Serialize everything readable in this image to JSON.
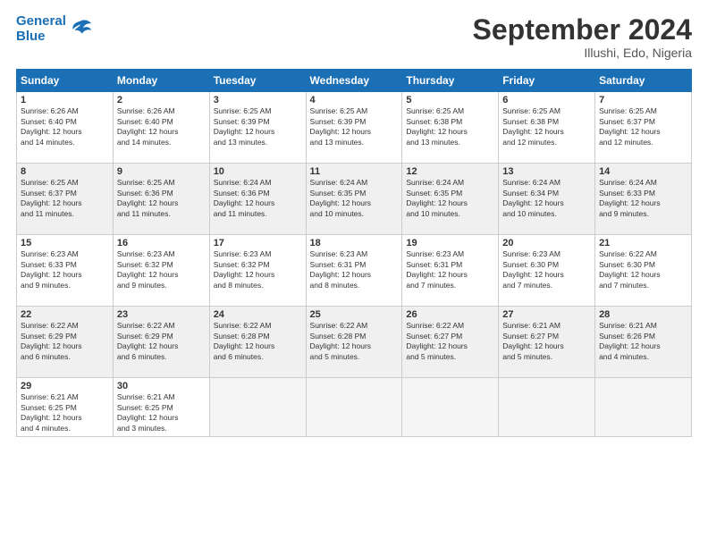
{
  "logo": {
    "line1": "General",
    "line2": "Blue"
  },
  "title": "September 2024",
  "subtitle": "Illushi, Edo, Nigeria",
  "weekdays": [
    "Sunday",
    "Monday",
    "Tuesday",
    "Wednesday",
    "Thursday",
    "Friday",
    "Saturday"
  ],
  "weeks": [
    [
      {
        "day": "1",
        "sunrise": "6:26 AM",
        "sunset": "6:40 PM",
        "daylight": "12 hours and 14 minutes."
      },
      {
        "day": "2",
        "sunrise": "6:26 AM",
        "sunset": "6:40 PM",
        "daylight": "12 hours and 14 minutes."
      },
      {
        "day": "3",
        "sunrise": "6:25 AM",
        "sunset": "6:39 PM",
        "daylight": "12 hours and 13 minutes."
      },
      {
        "day": "4",
        "sunrise": "6:25 AM",
        "sunset": "6:39 PM",
        "daylight": "12 hours and 13 minutes."
      },
      {
        "day": "5",
        "sunrise": "6:25 AM",
        "sunset": "6:38 PM",
        "daylight": "12 hours and 13 minutes."
      },
      {
        "day": "6",
        "sunrise": "6:25 AM",
        "sunset": "6:38 PM",
        "daylight": "12 hours and 12 minutes."
      },
      {
        "day": "7",
        "sunrise": "6:25 AM",
        "sunset": "6:37 PM",
        "daylight": "12 hours and 12 minutes."
      }
    ],
    [
      {
        "day": "8",
        "sunrise": "6:25 AM",
        "sunset": "6:37 PM",
        "daylight": "12 hours and 11 minutes."
      },
      {
        "day": "9",
        "sunrise": "6:25 AM",
        "sunset": "6:36 PM",
        "daylight": "12 hours and 11 minutes."
      },
      {
        "day": "10",
        "sunrise": "6:24 AM",
        "sunset": "6:36 PM",
        "daylight": "12 hours and 11 minutes."
      },
      {
        "day": "11",
        "sunrise": "6:24 AM",
        "sunset": "6:35 PM",
        "daylight": "12 hours and 10 minutes."
      },
      {
        "day": "12",
        "sunrise": "6:24 AM",
        "sunset": "6:35 PM",
        "daylight": "12 hours and 10 minutes."
      },
      {
        "day": "13",
        "sunrise": "6:24 AM",
        "sunset": "6:34 PM",
        "daylight": "12 hours and 10 minutes."
      },
      {
        "day": "14",
        "sunrise": "6:24 AM",
        "sunset": "6:33 PM",
        "daylight": "12 hours and 9 minutes."
      }
    ],
    [
      {
        "day": "15",
        "sunrise": "6:23 AM",
        "sunset": "6:33 PM",
        "daylight": "12 hours and 9 minutes."
      },
      {
        "day": "16",
        "sunrise": "6:23 AM",
        "sunset": "6:32 PM",
        "daylight": "12 hours and 9 minutes."
      },
      {
        "day": "17",
        "sunrise": "6:23 AM",
        "sunset": "6:32 PM",
        "daylight": "12 hours and 8 minutes."
      },
      {
        "day": "18",
        "sunrise": "6:23 AM",
        "sunset": "6:31 PM",
        "daylight": "12 hours and 8 minutes."
      },
      {
        "day": "19",
        "sunrise": "6:23 AM",
        "sunset": "6:31 PM",
        "daylight": "12 hours and 7 minutes."
      },
      {
        "day": "20",
        "sunrise": "6:23 AM",
        "sunset": "6:30 PM",
        "daylight": "12 hours and 7 minutes."
      },
      {
        "day": "21",
        "sunrise": "6:22 AM",
        "sunset": "6:30 PM",
        "daylight": "12 hours and 7 minutes."
      }
    ],
    [
      {
        "day": "22",
        "sunrise": "6:22 AM",
        "sunset": "6:29 PM",
        "daylight": "12 hours and 6 minutes."
      },
      {
        "day": "23",
        "sunrise": "6:22 AM",
        "sunset": "6:29 PM",
        "daylight": "12 hours and 6 minutes."
      },
      {
        "day": "24",
        "sunrise": "6:22 AM",
        "sunset": "6:28 PM",
        "daylight": "12 hours and 6 minutes."
      },
      {
        "day": "25",
        "sunrise": "6:22 AM",
        "sunset": "6:28 PM",
        "daylight": "12 hours and 5 minutes."
      },
      {
        "day": "26",
        "sunrise": "6:22 AM",
        "sunset": "6:27 PM",
        "daylight": "12 hours and 5 minutes."
      },
      {
        "day": "27",
        "sunrise": "6:21 AM",
        "sunset": "6:27 PM",
        "daylight": "12 hours and 5 minutes."
      },
      {
        "day": "28",
        "sunrise": "6:21 AM",
        "sunset": "6:26 PM",
        "daylight": "12 hours and 4 minutes."
      }
    ],
    [
      {
        "day": "29",
        "sunrise": "6:21 AM",
        "sunset": "6:25 PM",
        "daylight": "12 hours and 4 minutes."
      },
      {
        "day": "30",
        "sunrise": "6:21 AM",
        "sunset": "6:25 PM",
        "daylight": "12 hours and 3 minutes."
      },
      null,
      null,
      null,
      null,
      null
    ]
  ]
}
